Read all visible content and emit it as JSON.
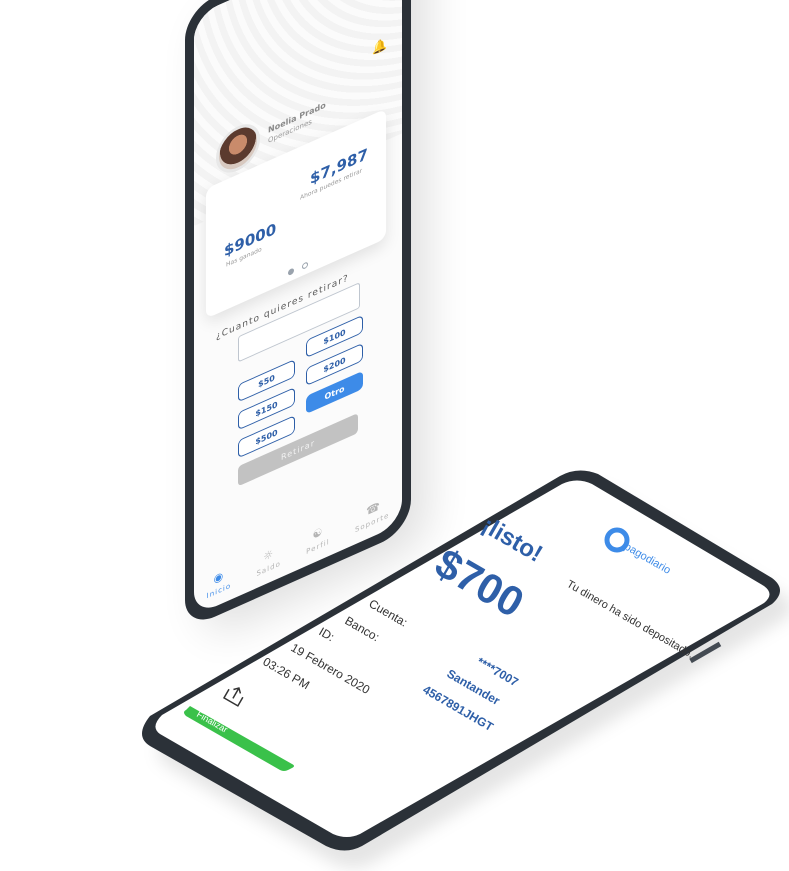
{
  "withdraw_screen": {
    "profile": {
      "name": "Noelia Prado",
      "role": "Operaciones"
    },
    "balance_card": {
      "earned_amount": "$9000",
      "earned_label": "Has ganado",
      "available_amount": "$7,987",
      "available_label": "Ahora puedes retirar"
    },
    "question": "¿Cuanto quieres retirar?",
    "amount_input_value": "",
    "quick_amounts": [
      "$50",
      "$100",
      "$150",
      "$200",
      "$500"
    ],
    "other_label": "Otro",
    "withdraw_button": "Retirar",
    "nav": [
      "Inicio",
      "Saldo",
      "Perfil",
      "Soporte"
    ],
    "colors": {
      "primary": "#2e5fa8",
      "accent": "#3d8be8",
      "disabled": "#c2c2c2"
    },
    "icons": [
      "bell-icon",
      "home-icon",
      "wallet-icon",
      "profile-icon",
      "headset-icon"
    ]
  },
  "confirmation_screen": {
    "brand": "pagodiario",
    "headline": "¡listo!",
    "amount": "$700",
    "message": "Tu dinero ha sido depositado.",
    "fields": [
      {
        "label": "Cuenta:",
        "value": "****7007"
      },
      {
        "label": "Banco:",
        "value": "Santander"
      },
      {
        "label": "ID:",
        "value": "4567891JHGT"
      }
    ],
    "date": "19 Febrero 2020",
    "time": "03:26 PM",
    "finish_button": "Finalizar",
    "colors": {
      "primary": "#2e5fa8",
      "success": "#3ac14a"
    },
    "icons": [
      "share-icon",
      "brand-logo-icon"
    ]
  }
}
